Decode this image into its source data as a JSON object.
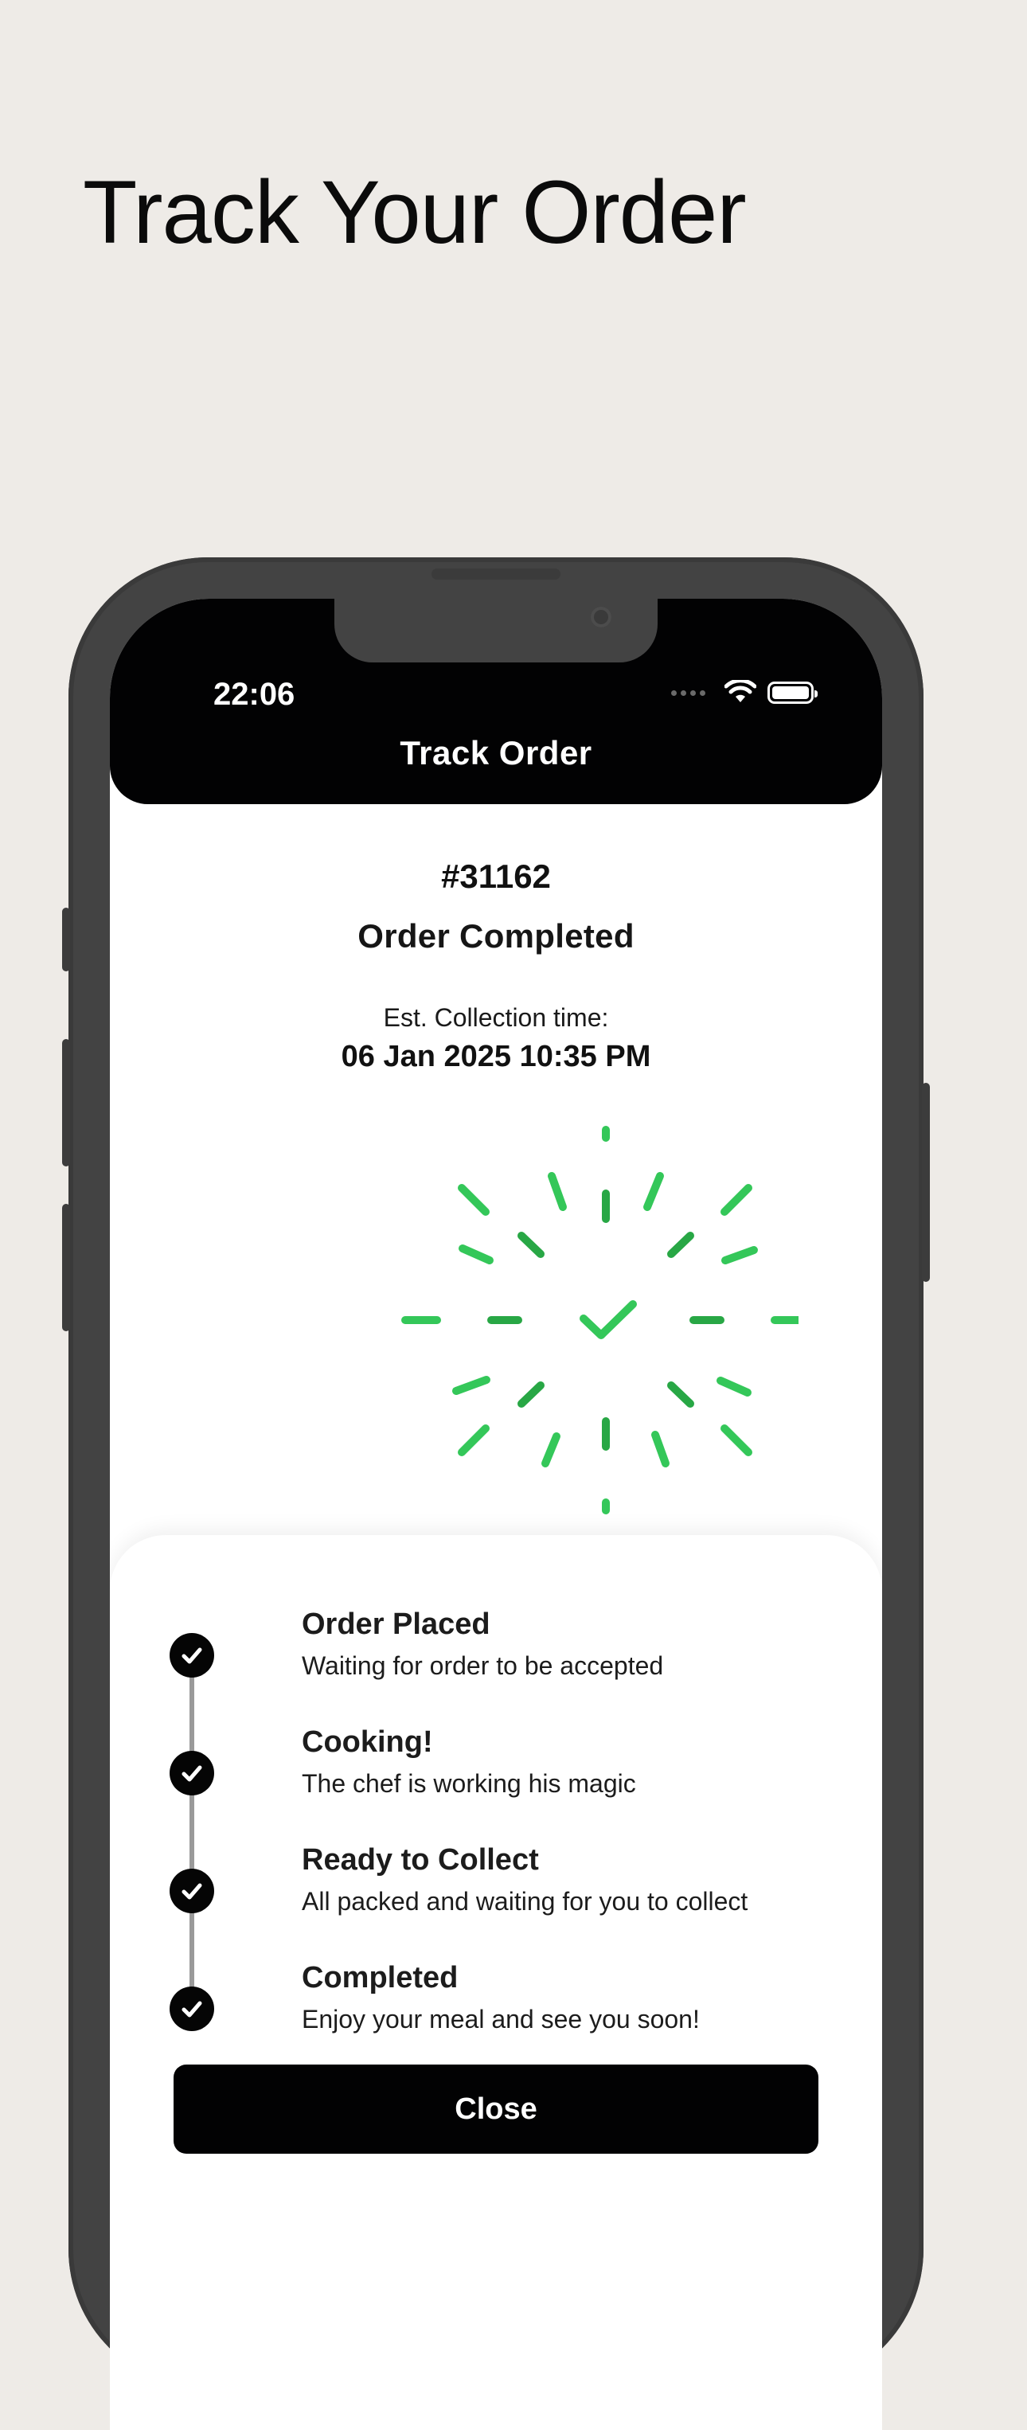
{
  "promo": {
    "heading": "Track Your Order"
  },
  "status_bar": {
    "time": "22:06"
  },
  "header": {
    "title": "Track Order"
  },
  "order": {
    "number": "#31162",
    "status": "Order Completed",
    "collection_label": "Est. Collection time:",
    "collection_time": "06 Jan 2025 10:35 PM"
  },
  "timeline": {
    "steps": [
      {
        "title": "Order Placed",
        "description": "Waiting for order to be accepted",
        "completed": true
      },
      {
        "title": "Cooking!",
        "description": "The chef is working his magic",
        "completed": true
      },
      {
        "title": "Ready to Collect",
        "description": "All packed and waiting for you to collect",
        "completed": true
      },
      {
        "title": "Completed",
        "description": "Enjoy your meal and see you soon!",
        "completed": true
      }
    ]
  },
  "actions": {
    "close_label": "Close"
  },
  "colors": {
    "background": "#eeebe7",
    "phone_frame": "#434343",
    "header": "#020203",
    "success_light": "#34c759",
    "success_dark": "#28a745",
    "text": "#1c1c1c"
  },
  "icons": {
    "success": "checkmark-burst-icon",
    "step": "check-circle-icon",
    "wifi": "wifi-icon",
    "battery": "battery-icon",
    "signal": "signal-icon"
  }
}
